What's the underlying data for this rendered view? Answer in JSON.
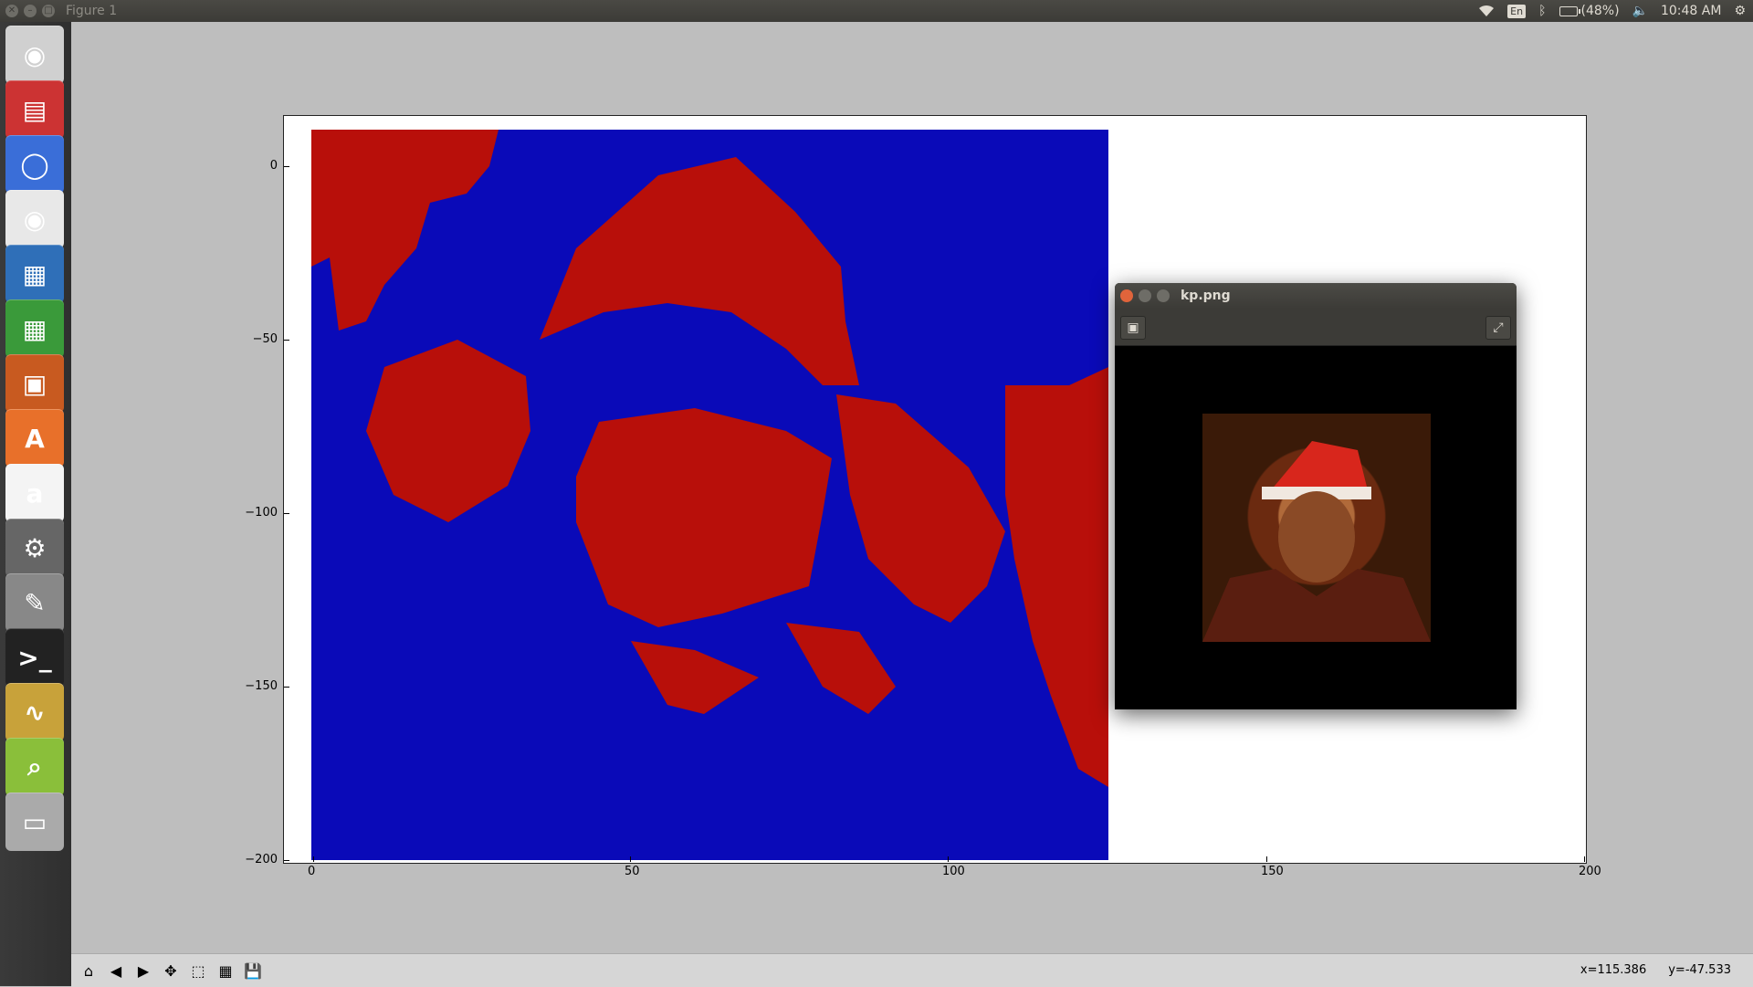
{
  "window": {
    "title": "Figure 1"
  },
  "tray": {
    "language": "En",
    "battery": "(48%)",
    "clock": "10:48 AM",
    "icons": [
      "wifi-icon",
      "keyboard-layout-icon",
      "bluetooth-icon",
      "battery-icon",
      "volume-icon",
      "settings-gear-icon"
    ]
  },
  "launcher": {
    "items": [
      {
        "name": "ubuntu-dash",
        "glyph": "◉"
      },
      {
        "name": "files",
        "glyph": "▤"
      },
      {
        "name": "chromium",
        "glyph": "◯"
      },
      {
        "name": "chrome",
        "glyph": "◉"
      },
      {
        "name": "writer",
        "glyph": "▦"
      },
      {
        "name": "calc",
        "glyph": "▦"
      },
      {
        "name": "impress",
        "glyph": "▣"
      },
      {
        "name": "software-center",
        "glyph": "A"
      },
      {
        "name": "amazon",
        "glyph": "a"
      },
      {
        "name": "system-settings",
        "glyph": "⚙"
      },
      {
        "name": "text-editor",
        "glyph": "✎"
      },
      {
        "name": "terminal",
        "glyph": ">_"
      },
      {
        "name": "oscilloscope",
        "glyph": "∿"
      },
      {
        "name": "image-viewer",
        "glyph": "⌕"
      },
      {
        "name": "trash",
        "glyph": "▭"
      }
    ]
  },
  "plot": {
    "x_ticks": [
      "0",
      "50",
      "100",
      "150",
      "200"
    ],
    "y_ticks": [
      "0",
      "−50",
      "−100",
      "−150",
      "−200"
    ],
    "image_colors": {
      "background": "#0a0ab8",
      "foreground": "#b80f0a"
    }
  },
  "viewer": {
    "title": "kp.png"
  },
  "toolbar": {
    "buttons": [
      "home-icon",
      "back-icon",
      "forward-icon",
      "pan-icon",
      "zoom-icon",
      "subplots-icon",
      "save-icon"
    ]
  },
  "status": {
    "x": "x=115.386",
    "y": "y=-47.533"
  }
}
